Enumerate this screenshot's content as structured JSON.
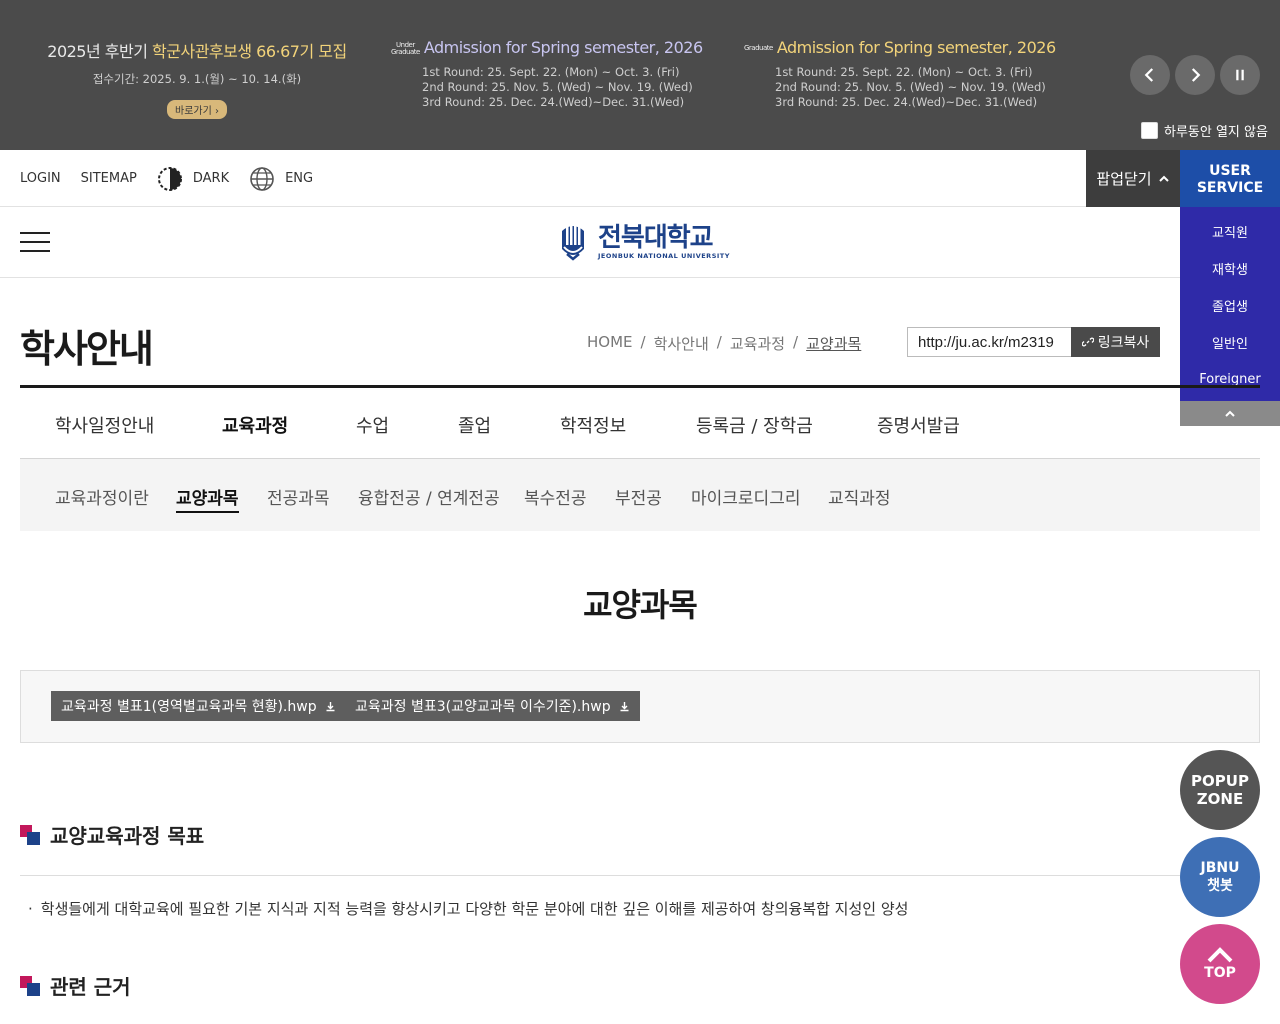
{
  "popup": {
    "promo1": {
      "prefix": "2025년 후반기 ",
      "accent": "학군사관후보생 66·67기 모집",
      "period": "접수기간: 2025. 9. 1.(월) ~ 10. 14.(화)",
      "button": "바로가기"
    },
    "promo2": {
      "sup_top": "Under",
      "sup_bottom": "Graduate",
      "title": "Admission for Spring semester, 2026",
      "lines": [
        "1st Round: 25. Sept. 22. (Mon) ~ Oct. 3. (Fri)",
        "2nd Round: 25. Nov. 5. (Wed) ~ Nov. 19. (Wed)",
        "3rd Round: 25. Dec. 24.(Wed)~Dec. 31.(Wed)"
      ]
    },
    "promo3": {
      "sup": "Graduate",
      "title": "Admission for Spring semester, 2026",
      "lines": [
        "1st Round: 25. Sept. 22. (Mon) ~ Oct. 3. (Fri)",
        "2nd Round: 25. Nov. 5. (Wed) ~ Nov. 19. (Wed)",
        "3rd Round: 25. Dec. 24.(Wed)~Dec. 31.(Wed)"
      ]
    },
    "no_show_today": "하루동안 열지 않음",
    "close_label": "팝업닫기"
  },
  "util": {
    "login": "LOGIN",
    "sitemap": "SITEMAP",
    "dark": "DARK",
    "eng": "ENG"
  },
  "user_service": {
    "title_line1": "USER",
    "title_line2": "SERVICE",
    "items": [
      "교직원",
      "재학생",
      "졸업생",
      "일반인",
      "Foreigner"
    ]
  },
  "logo": {
    "kr": "전북대학교",
    "en": "JEONBUK NATIONAL UNIVERSITY"
  },
  "page": {
    "title": "학사안내",
    "breadcrumb": [
      "HOME",
      "학사안내",
      "교육과정",
      "교양과목"
    ],
    "url": "http://ju.ac.kr/m2319",
    "copy_label": "링크복사"
  },
  "main_nav": [
    "학사일정안내",
    "교육과정",
    "수업",
    "졸업",
    "학적정보",
    "등록금 / 장학금",
    "증명서발급"
  ],
  "sub_nav": [
    "교육과정이란",
    "교양과목",
    "전공과목",
    "융합전공 / 연계전공",
    "복수전공",
    "부전공",
    "마이크로디그리",
    "교직과정"
  ],
  "content": {
    "title": "교양과목",
    "files": [
      "교육과정 별표1(영역별교육과목 현황).hwp",
      "교육과정 별표3(교양교과목 이수기준).hwp"
    ],
    "section1": "교양교육과정 목표",
    "section1_text": "학생들에게 대학교육에 필요한 기본 지식과 지적 능력을 향상시키고 다양한 학문 분야에 대한 깊은 이해를 제공하여 창의융복합 지성인 양성",
    "section2": "관련 근거"
  },
  "floating": {
    "popup_zone_1": "POPUP",
    "popup_zone_2": "ZONE",
    "chatbot_1": "JBNU",
    "chatbot_2": "챗봇",
    "top": "TOP"
  },
  "colors": {
    "brand_blue": "#1d4289",
    "service_purple": "#2f2aa8",
    "accent_pink": "#c2185b",
    "top_button": "#d24a8c"
  }
}
